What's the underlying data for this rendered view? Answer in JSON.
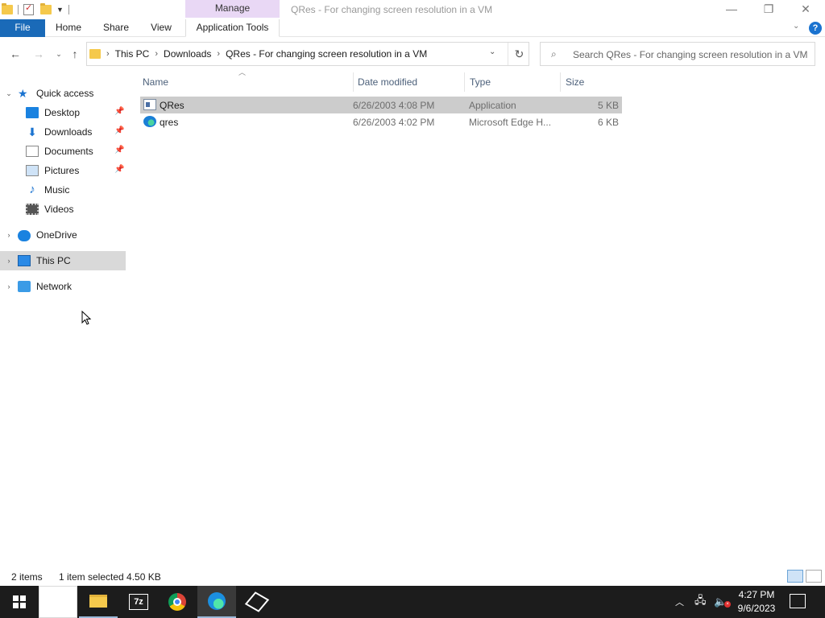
{
  "window": {
    "title": "QRes - For changing screen resolution in a VM",
    "context_tab_header": "Manage",
    "minimize": "—",
    "maximize": "❐",
    "close": "✕"
  },
  "ribbon": {
    "tabs": [
      {
        "label": "File"
      },
      {
        "label": "Home"
      },
      {
        "label": "Share"
      },
      {
        "label": "View"
      },
      {
        "label": "Application Tools"
      }
    ],
    "help": "?"
  },
  "address": {
    "crumbs": [
      "This PC",
      "Downloads",
      "QRes - For changing screen resolution in a VM"
    ]
  },
  "search": {
    "placeholder": "Search QRes - For changing screen resolution in a VM"
  },
  "nav_pane": {
    "items": [
      {
        "label": "Quick access",
        "icon": "star-icon"
      },
      {
        "label": "Desktop",
        "icon": "desktop-icon",
        "pinned": true
      },
      {
        "label": "Downloads",
        "icon": "download-icon",
        "pinned": true
      },
      {
        "label": "Documents",
        "icon": "document-icon",
        "pinned": true
      },
      {
        "label": "Pictures",
        "icon": "pictures-icon",
        "pinned": true
      },
      {
        "label": "Music",
        "icon": "music-icon"
      },
      {
        "label": "Videos",
        "icon": "video-icon"
      },
      {
        "label": "OneDrive",
        "icon": "cloud-icon"
      },
      {
        "label": "This PC",
        "icon": "computer-icon",
        "selected": true
      },
      {
        "label": "Network",
        "icon": "network-icon"
      }
    ]
  },
  "file_list": {
    "columns": [
      "Name",
      "Date modified",
      "Type",
      "Size"
    ],
    "rows": [
      {
        "name": "QRes",
        "date": "6/26/2003 4:08 PM",
        "type": "Application",
        "size": "5 KB",
        "icon": "application-icon",
        "selected": true
      },
      {
        "name": "qres",
        "date": "6/26/2003 4:02 PM",
        "type": "Microsoft Edge H...",
        "size": "6 KB",
        "icon": "edge-html-icon",
        "selected": false
      }
    ]
  },
  "status_bar": {
    "item_count": "2 items",
    "selection": "1 item selected  4.50 KB"
  },
  "taskbar": {
    "apps": [
      "start-icon",
      "search-icon",
      "file-explorer-icon",
      "7zip-icon",
      "chrome-icon",
      "edge-icon",
      "box-3d-icon"
    ],
    "time": "4:27 PM",
    "date": "9/6/2023"
  },
  "colors": {
    "file_tab": "#1a6ab8",
    "manage_tab": "#e9d8f5",
    "selection": "#cccccc",
    "taskbar": "#1c1c1c"
  }
}
